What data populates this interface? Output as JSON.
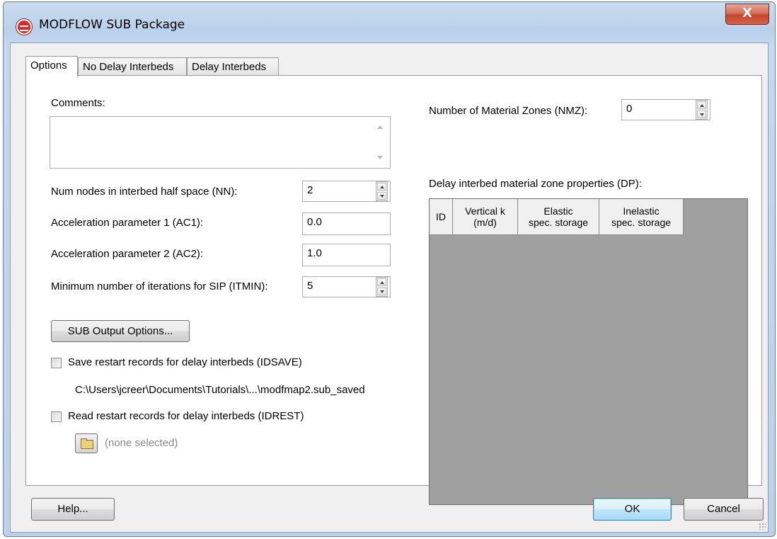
{
  "window": {
    "title": "MODFLOW SUB Package",
    "close_label": "X"
  },
  "tabs": [
    {
      "label": "Options"
    },
    {
      "label": "No Delay Interbeds"
    },
    {
      "label": "Delay Interbeds"
    }
  ],
  "options": {
    "comments_label": "Comments:",
    "comments_value": "",
    "nn_label": "Num nodes in interbed half space (NN):",
    "nn_value": "2",
    "ac1_label": "Acceleration parameter 1 (AC1):",
    "ac1_value": "0.0",
    "ac2_label": "Acceleration parameter 2 (AC2):",
    "ac2_value": "1.0",
    "itmin_label": "Minimum number of iterations for SIP (ITMIN):",
    "itmin_value": "5",
    "output_button": "SUB Output Options...",
    "idsave_label": "Save restart records for delay interbeds (IDSAVE)",
    "idsave_path": "C:\\Users\\jcreer\\Documents\\Tutorials\\...\\modfmap2.sub_saved",
    "idrest_label": "Read restart records for delay interbeds (IDREST)",
    "idrest_file": "(none selected)",
    "nmz_label": "Number of Material Zones (NMZ):",
    "nmz_value": "0",
    "dp_label": "Delay interbed material zone properties (DP):",
    "grid_columns": [
      {
        "line1": "ID",
        "line2": ""
      },
      {
        "line1": "Vertical k",
        "line2": "(m/d)"
      },
      {
        "line1": "Elastic",
        "line2": "spec. storage"
      },
      {
        "line1": "Inelastic",
        "line2": "spec. storage"
      }
    ]
  },
  "footer": {
    "help_button": "Help...",
    "ok_button": "OK",
    "cancel_button": "Cancel"
  },
  "colors": {
    "titlebar": "#b9d1ea",
    "close": "#c4452c",
    "grid_bg": "#a0a0a0",
    "dialog_bg": "#f0f0f0"
  }
}
